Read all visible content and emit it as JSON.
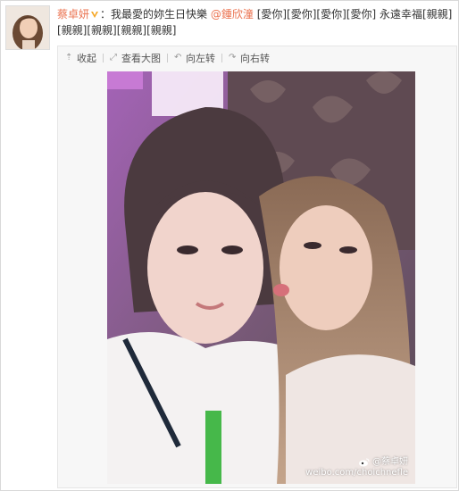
{
  "post": {
    "author": "蔡卓妍",
    "separator": "：",
    "text_start": "我最愛的妳生日快樂 ",
    "mention": "@鍾欣潼",
    "text_end": " [愛你][愛你][愛你][愛你] 永遠幸福[親親][親親][親親][親親][親親]"
  },
  "toolbar": {
    "collapse_label": "收起",
    "view_large_label": "查看大图",
    "rotate_left_label": "向左转",
    "rotate_right_label": "向右转"
  },
  "photo": {
    "watermark_account": "@蔡卓妍",
    "watermark_url": "weibo.com/choichnefle"
  },
  "icons": {
    "collapse": "arrow-up-icon",
    "view_large": "enlarge-icon",
    "rotate_left": "rotate-left-icon",
    "rotate_right": "rotate-right-icon"
  },
  "colors": {
    "link": "#eb7350",
    "toolbar_bg": "#f7f7f7"
  }
}
